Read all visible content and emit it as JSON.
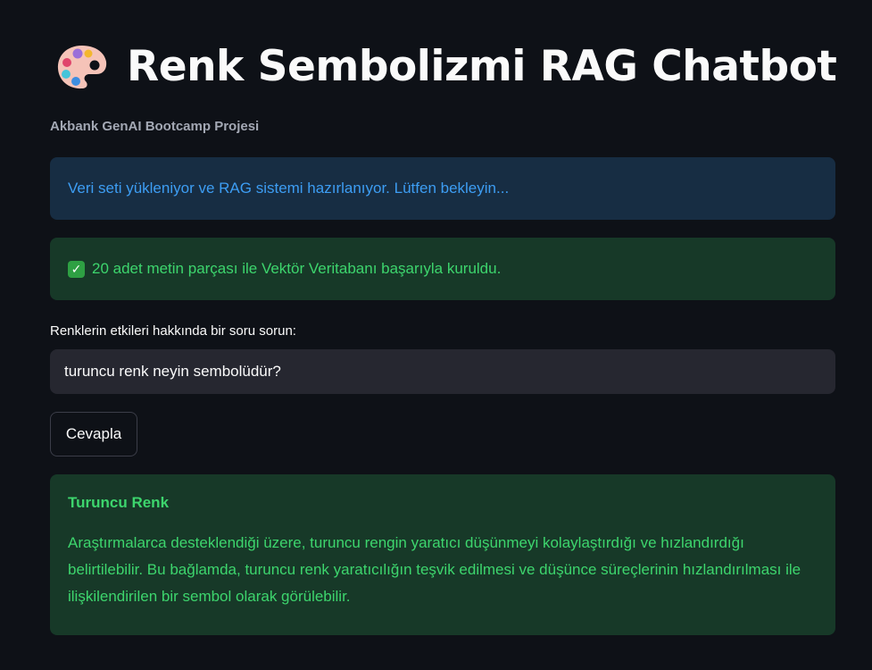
{
  "header": {
    "title": "Renk Sembolizmi RAG Chatbot",
    "subtitle": "Akbank GenAI Bootcamp Projesi",
    "icon": "artist-palette-icon"
  },
  "alerts": {
    "info": "Veri seti yükleniyor ve RAG sistemi hazırlanıyor. Lütfen bekleyin...",
    "success": "20 adet metin parçası ile Vektör Veritabanı başarıyla kuruldu."
  },
  "query": {
    "label": "Renklerin etkileri hakkında bir soru sorun:",
    "value": "turuncu renk neyin sembolüdür?"
  },
  "submit": {
    "label": "Cevapla"
  },
  "answer": {
    "heading": "Turuncu Renk",
    "text": "Araştırmalarca desteklendiği üzere, turuncu rengin yaratıcı düşünmeyi kolaylaştırdığı ve hızlandırdığı belirtilebilir. Bu bağlamda, turuncu renk yaratıcılığın teşvik edilmesi ve düşünce süreçlerinin hızlandırılması ile ilişkilendirilen bir sembol olarak görülebilir."
  },
  "colors": {
    "background": "#0e1117",
    "info_bg": "#172d43",
    "info_text": "#3d9df3",
    "success_bg": "#173928",
    "success_text": "#3dd56d",
    "input_bg": "#262730"
  }
}
